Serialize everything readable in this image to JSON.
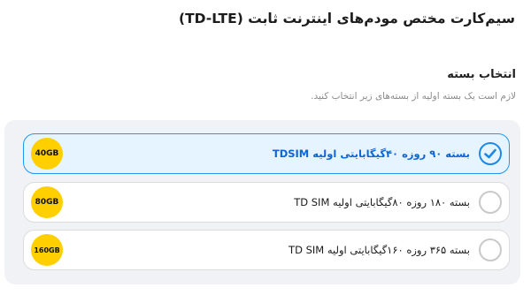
{
  "header": {
    "title": "سیم‌کارت مختص مودم‌های اینترنت ثابت (TD-LTE)"
  },
  "section": {
    "title": "انتخاب بسته",
    "subtitle": "لازم است یک بسته اولیه از بسته‌های زیر انتخاب کنید."
  },
  "packages": [
    {
      "label": "بسته ۹۰ روزه ۴۰گیگابایتی اولیه TDSIM",
      "badge": "40GB",
      "selected": true
    },
    {
      "label": "بسته ۱۸۰ روزه ۸۰گیگابایتی اولیه TD SIM",
      "badge": "80GB",
      "selected": false
    },
    {
      "label": "بسته ۳۶۵ روزه ۱۶۰گیگابایتی اولیه TD SIM",
      "badge": "160GB",
      "selected": false
    }
  ],
  "colors": {
    "accent": "#1e88e5",
    "selected_bg": "#e6f4ff",
    "badge": "#ffcf00",
    "panel_bg": "#f1f2f5"
  },
  "icons": {
    "selected": "check-circle-icon",
    "unselected": "radio-empty-icon"
  }
}
